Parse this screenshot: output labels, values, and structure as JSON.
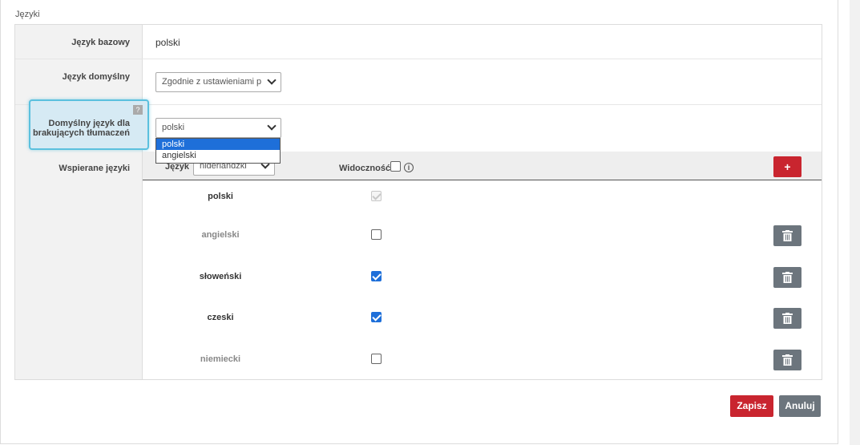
{
  "section_title": "Języki",
  "form": {
    "base_language": {
      "label": "Język bazowy",
      "value": "polski"
    },
    "default_language": {
      "label": "Język domyślny",
      "value": "Zgodnie z ustawieniami p"
    },
    "missing_translations": {
      "label_line1": "Domyślny język dla",
      "label_line2": "brakujących tłumaczeń",
      "help": "?",
      "value": "polski",
      "options": [
        "polski",
        "angielski"
      ],
      "selected_option": "polski"
    },
    "supported": {
      "label": "Wspierane języki",
      "header": {
        "language_label": "Język",
        "language_select": "niderlandzki",
        "visibility_label": "Widoczność",
        "info": "i",
        "add": "+"
      },
      "rows": [
        {
          "name": "polski",
          "visible": true,
          "locked": true
        },
        {
          "name": "angielski",
          "visible": false,
          "locked": false
        },
        {
          "name": "słoweński",
          "visible": true,
          "locked": false
        },
        {
          "name": "czeski",
          "visible": true,
          "locked": false
        },
        {
          "name": "niemiecki",
          "visible": false,
          "locked": false
        }
      ]
    }
  },
  "actions": {
    "save": "Zapisz",
    "cancel": "Anuluj"
  },
  "colors": {
    "accent_red": "#c9252f",
    "accent_blue": "#1e6fd9",
    "gray_button": "#6c757d",
    "highlight": "#5bc0de"
  }
}
